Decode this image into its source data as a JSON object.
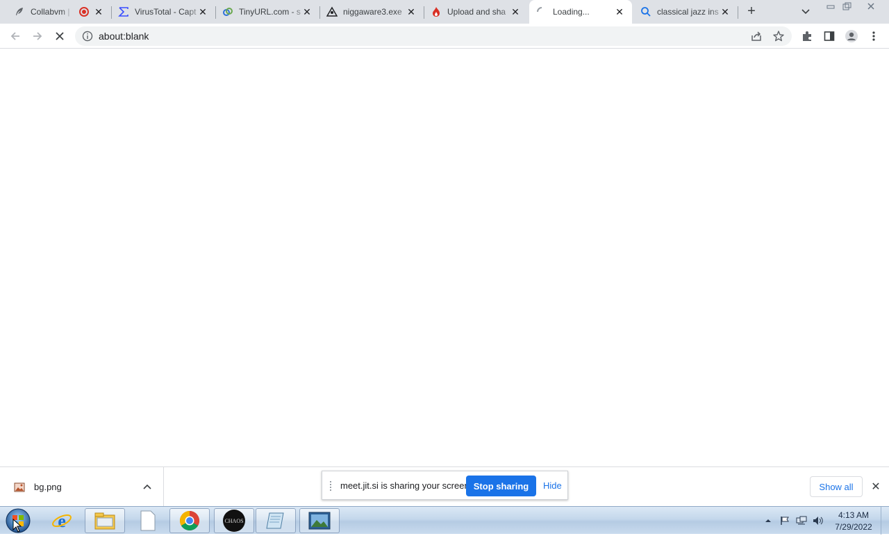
{
  "browser": {
    "tabs": [
      {
        "title": "Collabvm | ",
        "favicon": "feather-icon"
      },
      {
        "title": "VirusTotal - Capt",
        "favicon": "sigma-icon"
      },
      {
        "title": "TinyURL.com - s",
        "favicon": "tinyurl-icon"
      },
      {
        "title": "niggaware3.exe",
        "favicon": "triangle-person-icon"
      },
      {
        "title": "Upload and sha",
        "favicon": "flame-icon"
      },
      {
        "title": "Loading...",
        "favicon": "spinner-icon"
      },
      {
        "title": "classical jazz ins",
        "favicon": "search-icon"
      }
    ],
    "active_tab_index": 5,
    "address": "about:blank"
  },
  "download_shelf": {
    "file_name": "bg.png",
    "show_all_label": "Show all"
  },
  "sharing_bar": {
    "message": "meet.jit.si is sharing your screen.",
    "stop_label": "Stop sharing",
    "hide_label": "Hide"
  },
  "taskbar": {
    "apps": [
      "internet-explorer",
      "file-explorer",
      "document",
      "chrome",
      "chaos",
      "notepad",
      "photo-viewer"
    ],
    "chaos_label": "CHAOS",
    "time": "4:13 AM",
    "date": "7/29/2022"
  },
  "colors": {
    "accent": "#1a73e8",
    "tabstrip": "#dee1e6",
    "recording_dot": "#d93025"
  }
}
